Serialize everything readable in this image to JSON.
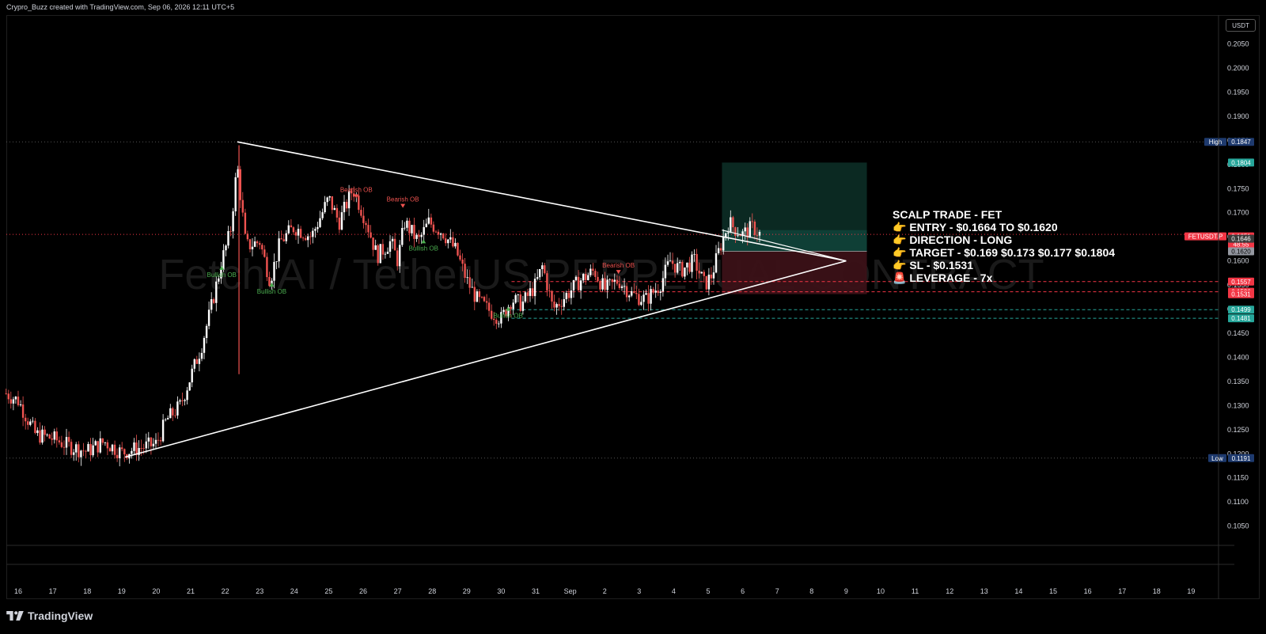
{
  "header": {
    "text": "Crypro_Buzz created with TradingView.com, Sep 06, 2026 12:11 UTC+5"
  },
  "currency_button": "USDT",
  "footer": {
    "brand": "TradingView"
  },
  "watermark": "Fetch.AI / TetherUS PERPETUAL CONTRACT",
  "colors": {
    "bull": "#ffffff",
    "bear": "#ef5350",
    "profit_zone": "#0c2b24",
    "loss_zone": "#3b1117",
    "green_tag": "#26a69a",
    "red_tag": "#f23645",
    "line": "#ffffff"
  },
  "trade_note": {
    "lines": [
      "SCALP TRADE - FET",
      "👉  ENTRY - $0.1664 TO  $0.1620",
      "👉  DIRECTION -  LONG",
      "👉  TARGET -  $0.169  $0.173 $0.177 $0.1804",
      "👉  SL - $0.1531",
      "🚨 LEVERAGE - 7x"
    ]
  },
  "chart_data": {
    "type": "candlestick",
    "symbol": "FETUSDT.P",
    "x_axis": {
      "tick_labels": [
        "16",
        "17",
        "18",
        "19",
        "20",
        "21",
        "22",
        "23",
        "24",
        "25",
        "26",
        "27",
        "28",
        "29",
        "30",
        "31",
        "Sep",
        "2",
        "3",
        "4",
        "5",
        "6",
        "7",
        "8",
        "9",
        "10",
        "11",
        "12",
        "13",
        "14",
        "15",
        "16",
        "17",
        "18",
        "19"
      ],
      "tick_day_index": [
        0,
        1,
        2,
        3,
        4,
        5,
        6,
        7,
        8,
        9,
        10,
        11,
        12,
        13,
        14,
        15,
        16,
        17,
        18,
        19,
        20,
        21,
        22,
        23,
        24,
        25,
        26,
        27,
        28,
        29,
        30,
        31,
        32,
        33,
        34
      ]
    },
    "y_axis": {
      "ylim": [
        0.101,
        0.211
      ],
      "tick_values": [
        0.105,
        0.11,
        0.115,
        0.12,
        0.125,
        0.13,
        0.135,
        0.14,
        0.145,
        0.15,
        0.155,
        0.16,
        0.165,
        0.17,
        0.175,
        0.18,
        0.185,
        0.19,
        0.195,
        0.2,
        0.205
      ],
      "tick_labels": [
        "0.1050",
        "0.1100",
        "0.1150",
        "0.1200",
        "0.1250",
        "0.1300",
        "0.1350",
        "0.1400",
        "0.1450",
        "0.1500",
        "0.1550",
        "0.1600",
        "0.1650",
        "0.1700",
        "0.1750",
        "0.1800",
        "0.1850",
        "0.1900",
        "0.1950",
        "0.2000",
        "0.2050"
      ],
      "position": "right"
    },
    "price_tags": [
      {
        "label": "High",
        "value": 0.1847,
        "text": "0.1847",
        "kind": "high"
      },
      {
        "label": "",
        "value": 0.1804,
        "text": "0.1804",
        "kind": "green"
      },
      {
        "label": "FETUSDT.P",
        "value": 0.1651,
        "text": "0.1651",
        "sub": "48:55",
        "kind": "current"
      },
      {
        "label": "",
        "value": 0.1646,
        "text": "0.1646",
        "kind": "gray"
      },
      {
        "label": "",
        "value": 0.162,
        "text": "0.1620",
        "kind": "lightgray"
      },
      {
        "label": "",
        "value": 0.1557,
        "text": "0.1557",
        "kind": "red"
      },
      {
        "label": "",
        "value": 0.1536,
        "text": "0.1536",
        "kind": "red"
      },
      {
        "label": "",
        "value": 0.1531,
        "text": "0.1531",
        "kind": "red"
      },
      {
        "label": "",
        "value": 0.1499,
        "text": "0.1499",
        "kind": "green"
      },
      {
        "label": "",
        "value": 0.1481,
        "text": "0.1481",
        "kind": "green"
      },
      {
        "label": "Low",
        "value": 0.1191,
        "text": "0.1191",
        "kind": "low"
      }
    ],
    "hlines": [
      {
        "value": 0.1847,
        "style": "dotted",
        "color": "#555"
      },
      {
        "value": 0.1655,
        "style": "dotted",
        "color": "#f23645"
      },
      {
        "value": 0.1557,
        "style": "dashed",
        "color": "#f23645"
      },
      {
        "value": 0.1536,
        "style": "dashed",
        "color": "#f23645"
      },
      {
        "value": 0.1499,
        "style": "dashed",
        "color": "#26a69a"
      },
      {
        "value": 0.1481,
        "style": "dashed",
        "color": "#26a69a"
      },
      {
        "value": 0.1191,
        "style": "dotted",
        "color": "#555"
      }
    ],
    "trendlines": [
      {
        "from": [
          6.35,
          0.1847
        ],
        "to": [
          24.0,
          0.16
        ]
      },
      {
        "from": [
          3.1,
          0.1193
        ],
        "to": [
          24.0,
          0.16
        ]
      }
    ],
    "position_box": {
      "x0": 20.4,
      "x1": 24.6,
      "entry": 0.162,
      "target": 0.1804,
      "stop": 0.1531
    },
    "order_blocks": [
      {
        "type": "Bullish OB",
        "day": 5.9,
        "price": 0.1575
      },
      {
        "type": "Bullish OB",
        "day": 7.35,
        "price": 0.154
      },
      {
        "type": "Bearish OB",
        "day": 9.8,
        "price": 0.173
      },
      {
        "type": "Bearish OB",
        "day": 11.15,
        "price": 0.171
      },
      {
        "type": "Bullish OB",
        "day": 11.75,
        "price": 0.163
      },
      {
        "type": "Bullish OB",
        "day": 14.2,
        "price": 0.149
      },
      {
        "type": "Bearish OB",
        "day": 17.4,
        "price": 0.1573
      }
    ],
    "price_path": [
      {
        "day": -0.35,
        "close": 0.1325
      },
      {
        "day": 0.0,
        "close": 0.131
      },
      {
        "day": 0.5,
        "close": 0.124
      },
      {
        "day": 1.0,
        "close": 0.1232
      },
      {
        "day": 1.5,
        "close": 0.1215
      },
      {
        "day": 2.0,
        "close": 0.1205
      },
      {
        "day": 2.5,
        "close": 0.1225
      },
      {
        "day": 3.0,
        "close": 0.1202
      },
      {
        "day": 3.5,
        "close": 0.1212
      },
      {
        "day": 4.0,
        "close": 0.122
      },
      {
        "day": 4.3,
        "close": 0.127
      },
      {
        "day": 4.7,
        "close": 0.13
      },
      {
        "day": 5.0,
        "close": 0.136
      },
      {
        "day": 5.3,
        "close": 0.142
      },
      {
        "day": 5.6,
        "close": 0.1505
      },
      {
        "day": 5.9,
        "close": 0.16
      },
      {
        "day": 6.15,
        "close": 0.166
      },
      {
        "day": 6.35,
        "close": 0.18
      },
      {
        "day": 6.6,
        "close": 0.163
      },
      {
        "day": 7.0,
        "close": 0.164
      },
      {
        "day": 7.3,
        "close": 0.156
      },
      {
        "day": 7.6,
        "close": 0.164
      },
      {
        "day": 8.0,
        "close": 0.167
      },
      {
        "day": 8.5,
        "close": 0.165
      },
      {
        "day": 9.0,
        "close": 0.173
      },
      {
        "day": 9.3,
        "close": 0.168
      },
      {
        "day": 9.7,
        "close": 0.175
      },
      {
        "day": 10.1,
        "close": 0.168
      },
      {
        "day": 10.4,
        "close": 0.161
      },
      {
        "day": 10.8,
        "close": 0.164
      },
      {
        "day": 11.0,
        "close": 0.16
      },
      {
        "day": 11.2,
        "close": 0.168
      },
      {
        "day": 11.6,
        "close": 0.164
      },
      {
        "day": 11.9,
        "close": 0.168
      },
      {
        "day": 12.3,
        "close": 0.166
      },
      {
        "day": 12.7,
        "close": 0.162
      },
      {
        "day": 13.0,
        "close": 0.156
      },
      {
        "day": 13.3,
        "close": 0.152
      },
      {
        "day": 13.6,
        "close": 0.15
      },
      {
        "day": 14.0,
        "close": 0.148
      },
      {
        "day": 14.3,
        "close": 0.152
      },
      {
        "day": 14.6,
        "close": 0.151
      },
      {
        "day": 15.0,
        "close": 0.155
      },
      {
        "day": 15.2,
        "close": 0.159
      },
      {
        "day": 15.5,
        "close": 0.15
      },
      {
        "day": 15.9,
        "close": 0.153
      },
      {
        "day": 16.3,
        "close": 0.156
      },
      {
        "day": 16.7,
        "close": 0.158
      },
      {
        "day": 17.0,
        "close": 0.154
      },
      {
        "day": 17.4,
        "close": 0.156
      },
      {
        "day": 17.8,
        "close": 0.153
      },
      {
        "day": 18.2,
        "close": 0.152
      },
      {
        "day": 18.6,
        "close": 0.155
      },
      {
        "day": 18.9,
        "close": 0.16
      },
      {
        "day": 19.2,
        "close": 0.158
      },
      {
        "day": 19.6,
        "close": 0.16
      },
      {
        "day": 19.9,
        "close": 0.155
      },
      {
        "day": 20.1,
        "close": 0.157
      },
      {
        "day": 20.35,
        "close": 0.163
      },
      {
        "day": 20.6,
        "close": 0.168
      },
      {
        "day": 20.8,
        "close": 0.1665
      },
      {
        "day": 21.0,
        "close": 0.1655
      },
      {
        "day": 21.3,
        "close": 0.167
      },
      {
        "day": 21.55,
        "close": 0.1651
      }
    ]
  }
}
